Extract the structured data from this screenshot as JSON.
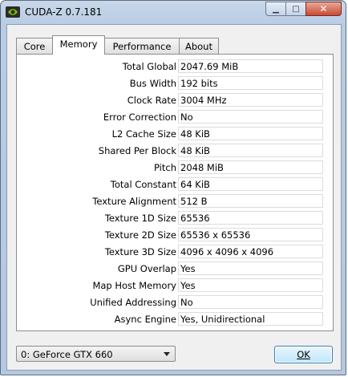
{
  "window": {
    "title": "CUDA-Z 0.7.181",
    "minimize_glyph": "▁",
    "maximize_glyph": "□",
    "close_glyph": "✕"
  },
  "tabs": [
    {
      "label": "Core",
      "active": false
    },
    {
      "label": "Memory",
      "active": true
    },
    {
      "label": "Performance",
      "active": false
    },
    {
      "label": "About",
      "active": false
    }
  ],
  "memory": {
    "rows": [
      {
        "label": "Total Global",
        "value": "2047.69 MiB"
      },
      {
        "label": "Bus Width",
        "value": "192 bits"
      },
      {
        "label": "Clock Rate",
        "value": "3004 MHz"
      },
      {
        "label": "Error Correction",
        "value": "No"
      },
      {
        "label": "L2 Cache Size",
        "value": "48 KiB"
      },
      {
        "label": "Shared Per Block",
        "value": "48 KiB"
      },
      {
        "label": "Pitch",
        "value": "2048 MiB"
      },
      {
        "label": "Total Constant",
        "value": "64 KiB"
      },
      {
        "label": "Texture Alignment",
        "value": "512 B"
      },
      {
        "label": "Texture 1D Size",
        "value": "65536"
      },
      {
        "label": "Texture 2D Size",
        "value": "65536 x 65536"
      },
      {
        "label": "Texture 3D Size",
        "value": "4096 x 4096 x 4096"
      },
      {
        "label": "GPU Overlap",
        "value": "Yes"
      },
      {
        "label": "Map Host Memory",
        "value": "Yes"
      },
      {
        "label": "Unified Addressing",
        "value": "No"
      },
      {
        "label": "Async Engine",
        "value": "Yes, Unidirectional"
      }
    ]
  },
  "device_select": {
    "selected": "0: GeForce GTX 660"
  },
  "ok_button": {
    "label": "OK"
  },
  "colors": {
    "accent": "#3c7fb1",
    "nvidia_green": "#76b900"
  }
}
